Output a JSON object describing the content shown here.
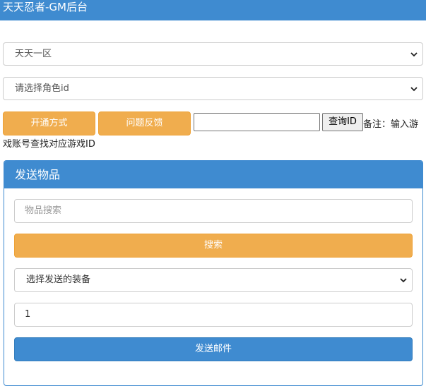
{
  "header": {
    "title": "天天忍者-GM后台"
  },
  "server_select": {
    "selected": "天天一区"
  },
  "role_select": {
    "selected": "请选择角色id"
  },
  "actions": {
    "open_method_label": "开通方式",
    "feedback_label": "问题反馈",
    "query_input_value": "",
    "query_button_label": "查询ID",
    "note": "备注：输入游戏账号查找对应游戏ID"
  },
  "send_panel": {
    "title": "发送物品",
    "search_placeholder": "物品搜索",
    "search_button_label": "搜索",
    "equip_select": "选择发送的装备",
    "quantity_value": "1",
    "send_button_label": "发送邮件"
  },
  "colors": {
    "primary": "#3f8bd0",
    "warning": "#f0ad4e"
  }
}
